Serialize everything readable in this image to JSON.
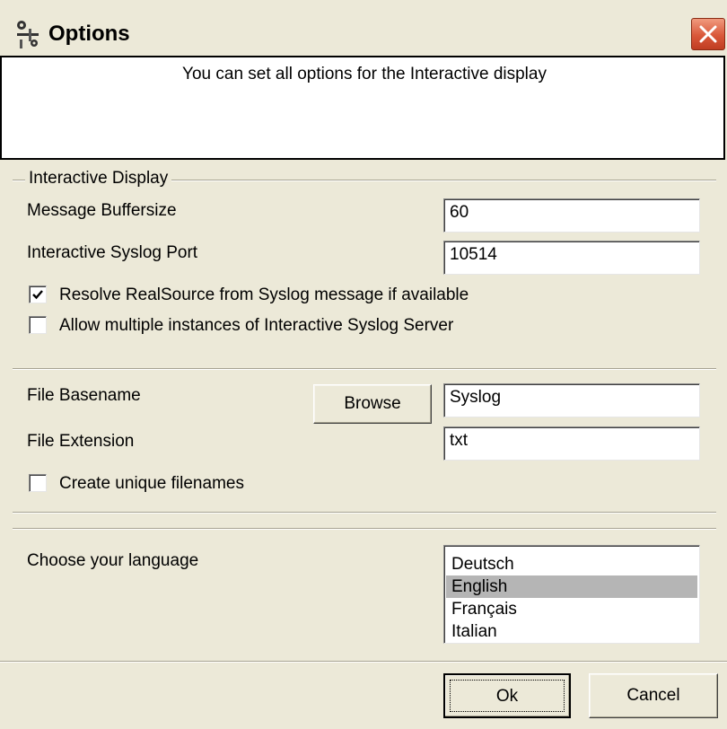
{
  "window": {
    "title": "Options",
    "icon": "options-app-icon",
    "close_icon": "close-icon",
    "close_color": "#d9583a"
  },
  "header": {
    "text": "You can set all options for the Interactive display"
  },
  "interactive_display": {
    "group_label": "Interactive Display",
    "buffer_label": "Message Buffersize",
    "buffer_value": "60",
    "port_label": "Interactive Syslog Port",
    "port_value": "10514",
    "resolve_label": "Resolve RealSource from Syslog message if available",
    "resolve_checked": true,
    "multiple_label": "Allow multiple instances of Interactive Syslog Server",
    "multiple_checked": false
  },
  "file": {
    "basename_label": "File Basename",
    "browse_label": "Browse",
    "basename_value": "Syslog",
    "extension_label": "File Extension",
    "extension_value": "txt",
    "unique_label": "Create unique filenames",
    "unique_checked": false
  },
  "language": {
    "label": "Choose your language",
    "options": [
      "Deutsch",
      "English",
      "Français",
      "Italian"
    ],
    "selected": "English"
  },
  "footer": {
    "ok_label": "Ok",
    "cancel_label": "Cancel"
  }
}
